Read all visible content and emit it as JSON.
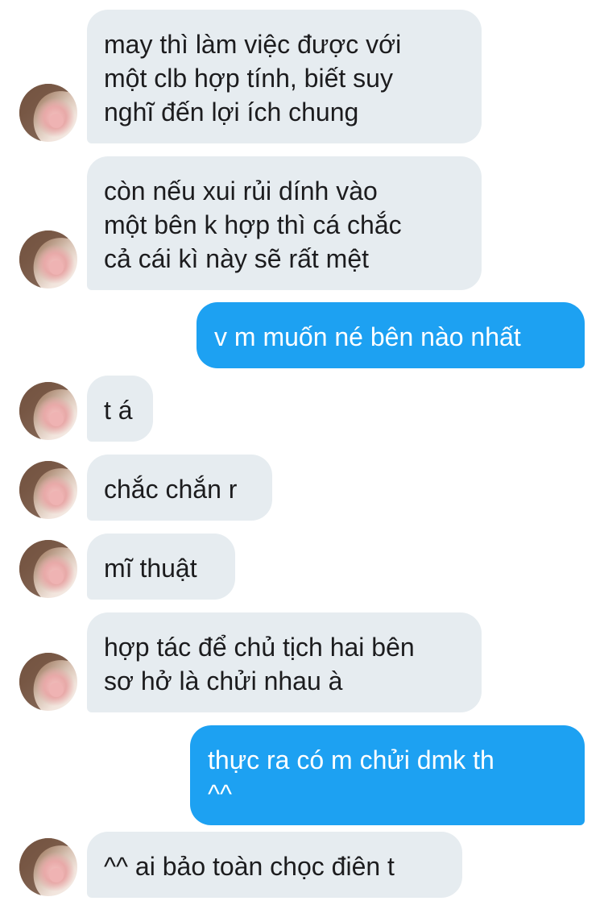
{
  "messages": [
    {
      "side": "in",
      "text": "may thì làm việc được với\nmột clb hợp tính, biết suy\nnghĩ đến lợi ích chung"
    },
    {
      "side": "in",
      "text": "còn nếu xui rủi dính vào\nmột bên k hợp thì cá chắc\ncả cái kì này sẽ rất mệt"
    },
    {
      "side": "out",
      "text": "v m muốn né bên nào nhất"
    },
    {
      "side": "in",
      "text": "t á"
    },
    {
      "side": "in",
      "text": "chắc chắn r"
    },
    {
      "side": "in",
      "text": "mĩ thuật"
    },
    {
      "side": "in",
      "text": "hợp tác để chủ tịch hai bên\nsơ hở là chửi nhau à"
    },
    {
      "side": "out",
      "text": "thực ra có m chửi dmk th\n^^"
    },
    {
      "side": "in",
      "text": "^^ ai bảo toàn chọc điên t"
    }
  ],
  "colors": {
    "incoming_bubble": "#e6ecf0",
    "outgoing_bubble": "#1da1f2",
    "incoming_text": "#1c1c1e",
    "outgoing_text": "#ffffff"
  },
  "icons": {
    "avatar": "profile-photo"
  }
}
